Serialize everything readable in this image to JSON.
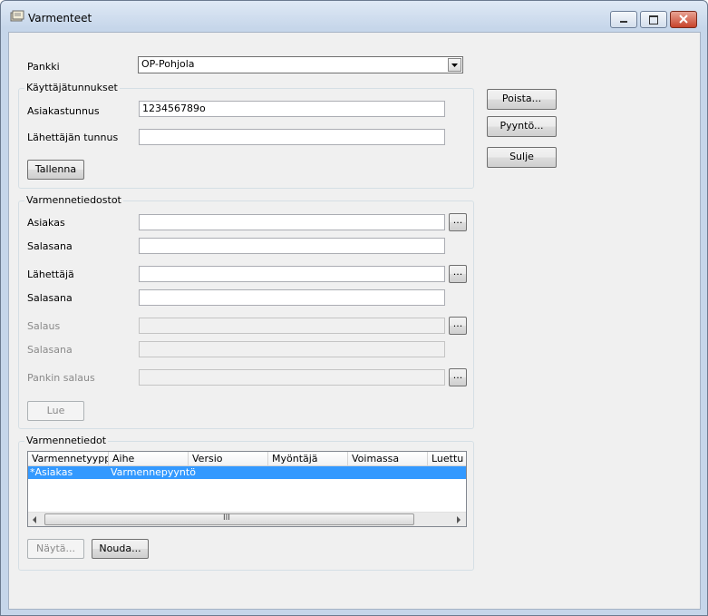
{
  "window": {
    "title": "Varmenteet"
  },
  "form": {
    "bank_label": "Pankki",
    "bank_value": "OP-Pohjola",
    "credentials_group": "Käyttäjätunnukset",
    "customer_id_label": "Asiakastunnus",
    "customer_id_value": "123456789o",
    "sender_id_label": "Lähettäjän tunnus",
    "sender_id_value": "",
    "save_label": "Tallenna"
  },
  "side_buttons": {
    "delete": "Poista...",
    "request": "Pyyntö...",
    "close": "Sulje"
  },
  "files": {
    "group": "Varmennetiedostot",
    "customer_label": "Asiakas",
    "customer_password_label": "Salasana",
    "sender_label": "Lähettäjä",
    "sender_password_label": "Salasana",
    "encryption_label": "Salaus",
    "encryption_password_label": "Salasana",
    "bank_encryption_label": "Pankin salaus",
    "browse_label": "...",
    "read_label": "Lue"
  },
  "details": {
    "group": "Varmennetiedot",
    "columns": [
      "Varmennetyyppi",
      "Aihe",
      "Versio",
      "Myöntäjä",
      "Voimassa",
      "Luettu"
    ],
    "rows": [
      {
        "type": "*Asiakas",
        "subject": "Varmennepyyntö"
      }
    ],
    "scroll_grip": "III",
    "show_label": "Näytä...",
    "fetch_label": "Nouda..."
  }
}
